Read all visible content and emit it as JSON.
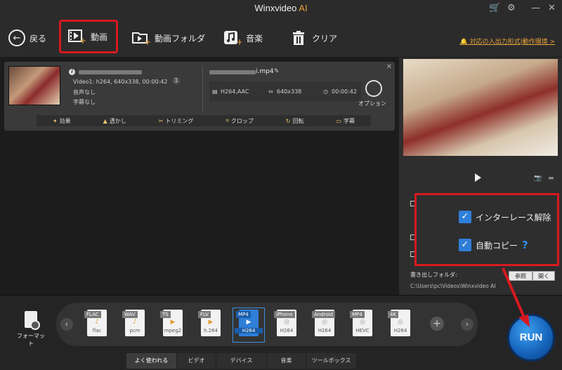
{
  "app": {
    "title": "Winxvideo",
    "title_ai": "AI"
  },
  "toolbar": {
    "back": "戻る",
    "video": "動画",
    "video_folder": "動画フォルダ",
    "music": "音楽",
    "clear": "クリア",
    "notice": "対応の入出力形式|動作環境 >"
  },
  "file": {
    "video_info": "Video1: h264, 640x338, 00:00:42",
    "audio": "音声なし",
    "subtitle": "字幕なし",
    "output_name": "i.mp4",
    "out_codec": "H264,AAC",
    "out_res": "640x338",
    "out_dur": "00:00:42",
    "option": "オプション",
    "edit": [
      "効果",
      "透かし",
      "トリミング",
      "クロップ",
      "回転",
      "字幕"
    ]
  },
  "right": {
    "deinterlace": "インターレース解除",
    "autocopy": "自動コピー",
    "help": "?",
    "out_folder_label": "書き出しフォルダ:",
    "out_path": "C:\\Users\\pc\\Videos\\Winxvideo AI",
    "browse": "参照",
    "open": "開く"
  },
  "bottom": {
    "format_label": "フォーマット",
    "formats": [
      {
        "tag": "FLAC",
        "sub": "flac"
      },
      {
        "tag": "WAV",
        "sub": "pcm"
      },
      {
        "tag": "TS",
        "sub": "mpeg2"
      },
      {
        "tag": "FLV",
        "sub": "h.264"
      },
      {
        "tag": "MP4",
        "sub": "H264"
      },
      {
        "tag": "iPhone",
        "sub": "H264"
      },
      {
        "tag": "Android",
        "sub": "H264"
      },
      {
        "tag": "MP4",
        "sub": "HEVC"
      },
      {
        "tag": "4K",
        "sub": "H264"
      }
    ],
    "tabs": [
      "よく使われる",
      "ビデオ",
      "デバイス",
      "音楽",
      "ツールボックス"
    ],
    "run": "RUN"
  },
  "colors": {
    "accent": "#2f7fd8",
    "highlight": "#d7191f",
    "notice": "#e9a13b"
  }
}
